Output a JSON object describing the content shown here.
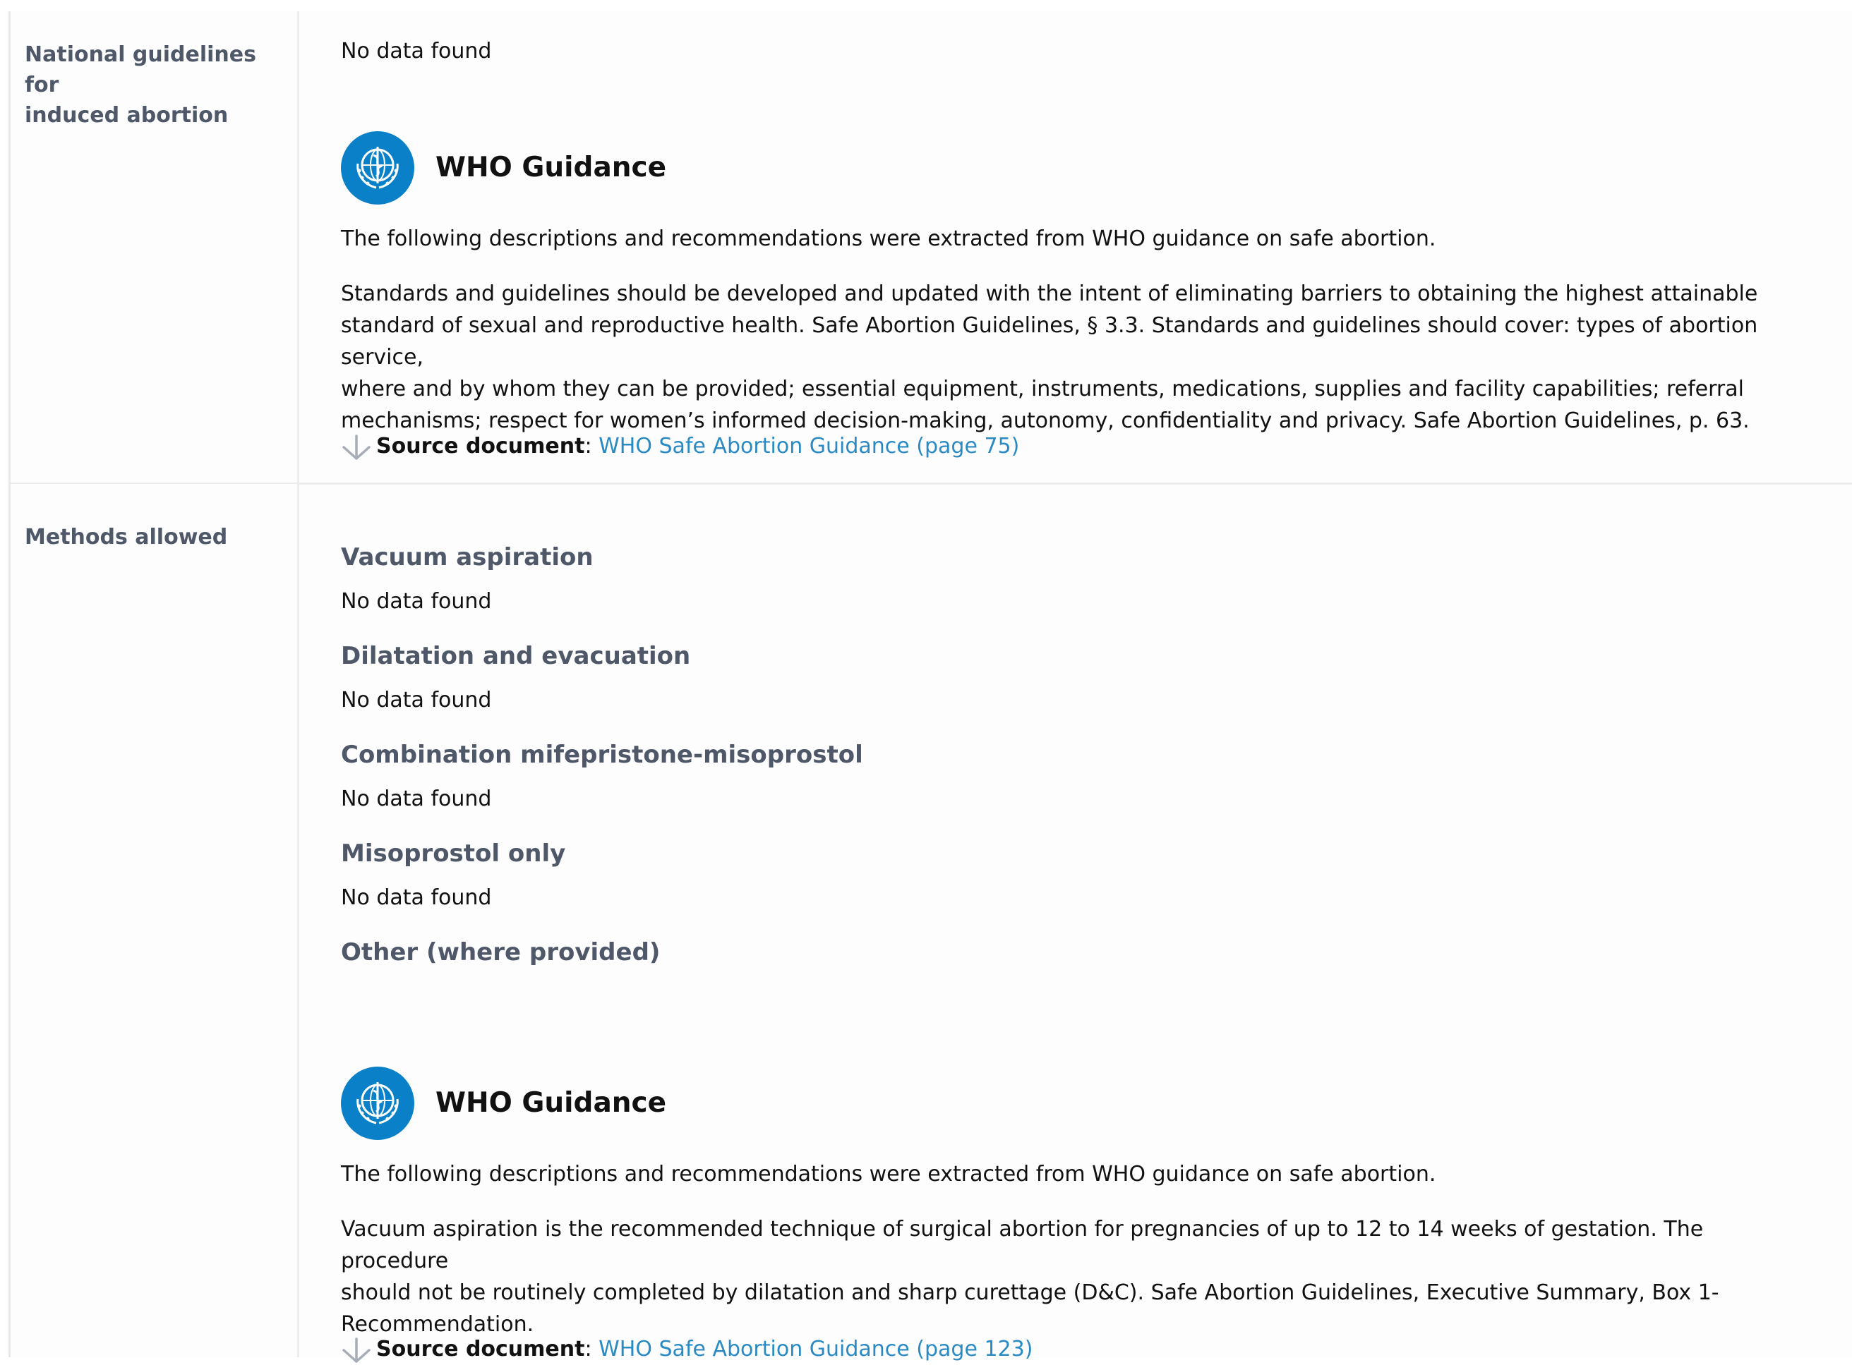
{
  "rows": [
    {
      "label_line1": "National guidelines for",
      "label_line2": "induced abortion",
      "status": "No data found",
      "who": {
        "title": "WHO Guidance",
        "intro": "The following descriptions and recommendations were extracted from WHO guidance on safe abortion.",
        "body_lines": [
          "Standards and guidelines should be developed and updated with the intent of eliminating barriers to obtaining the highest attainable",
          "standard of sexual and reproductive health. Safe Abortion Guidelines, § 3.3. Standards and guidelines should cover: types of abortion service,",
          "where and by whom they can be provided; essential equipment, instruments, medications, supplies and facility capabilities; referral",
          "mechanisms; respect for women’s informed decision-making, autonomy, confidentiality and privacy. Safe Abortion Guidelines, p. 63."
        ],
        "source_label": "Source document",
        "source_sep": ":",
        "source_link": "WHO Safe Abortion Guidance (page 75)"
      }
    },
    {
      "label": "Methods allowed",
      "methods": [
        {
          "name": "Vacuum aspiration",
          "status": "No data found"
        },
        {
          "name": "Dilatation and evacuation",
          "status": "No data found"
        },
        {
          "name": "Combination mifepristone-misoprostol",
          "status": "No data found"
        },
        {
          "name": "Misoprostol only",
          "status": "No data found"
        },
        {
          "name": "Other (where provided)"
        }
      ],
      "who": {
        "title": "WHO Guidance",
        "intro": "The following descriptions and recommendations were extracted from WHO guidance on safe abortion.",
        "body_lines": [
          "Vacuum aspiration is the recommended technique of surgical abortion for pregnancies of up to 12 to 14 weeks of gestation. The procedure",
          "should not be routinely completed by dilatation and sharp curettage (D&C). Safe Abortion Guidelines, Executive Summary, Box 1-",
          "Recommendation."
        ],
        "source_label": "Source document",
        "source_sep": ":",
        "source_link": "WHO Safe Abortion Guidance (page 123)"
      }
    }
  ],
  "colors": {
    "label_text": "#4f5869",
    "link": "#2a8bc4",
    "who_blue": "#0a80c8",
    "divider": "#ececee"
  },
  "icons": {
    "who_logo": "who-emblem-icon",
    "source_arrow": "down-arrow-icon"
  }
}
